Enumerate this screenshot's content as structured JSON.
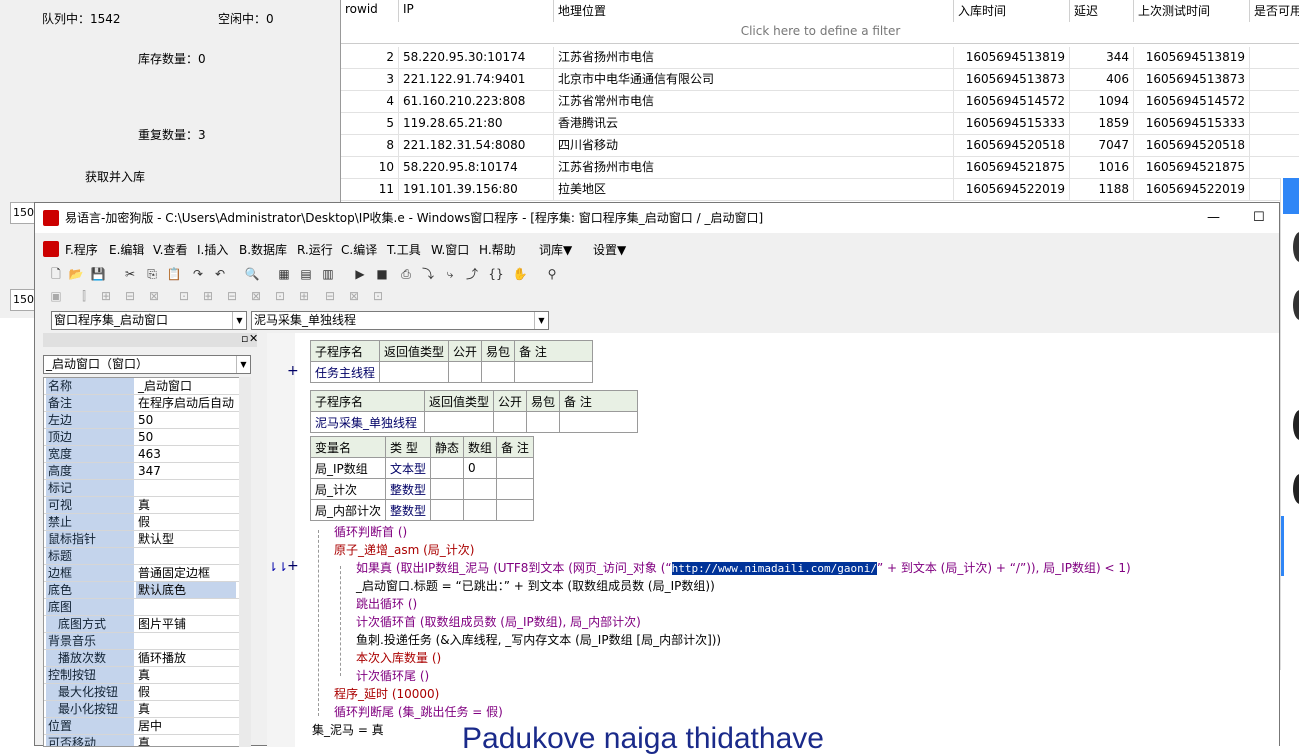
{
  "stats": {
    "queue": "队列中：1542",
    "idle": "空闲中：0",
    "stock": "库存数量：0",
    "dup": "重复数量：3",
    "fetch": "获取并入库",
    "n1": "150",
    "n2": "150"
  },
  "grid": {
    "headers": [
      "rowid",
      "IP",
      "地理位置",
      "入库时间",
      "延迟",
      "上次测试时间",
      "是否可用"
    ],
    "filter": "Click here to define a filter",
    "rows": [
      {
        "id": "2",
        "ip": "58.220.95.30:10174",
        "loc": "江苏省扬州市电信",
        "t": "1605694513819",
        "d": "344",
        "lt": "1605694513819"
      },
      {
        "id": "3",
        "ip": "221.122.91.74:9401",
        "loc": "北京市中电华通通信有限公司",
        "t": "1605694513873",
        "d": "406",
        "lt": "1605694513873"
      },
      {
        "id": "4",
        "ip": "61.160.210.223:808",
        "loc": "江苏省常州市电信",
        "t": "1605694514572",
        "d": "1094",
        "lt": "1605694514572"
      },
      {
        "id": "5",
        "ip": "119.28.65.21:80",
        "loc": "香港腾讯云",
        "t": "1605694515333",
        "d": "1859",
        "lt": "1605694515333"
      },
      {
        "id": "8",
        "ip": "221.182.31.54:8080",
        "loc": "四川省移动",
        "t": "1605694520518",
        "d": "7047",
        "lt": "1605694520518"
      },
      {
        "id": "10",
        "ip": "58.220.95.8:10174",
        "loc": "江苏省扬州市电信",
        "t": "1605694521875",
        "d": "1016",
        "lt": "1605694521875"
      },
      {
        "id": "11",
        "ip": "191.101.39.156:80",
        "loc": "拉美地区",
        "t": "1605694522019",
        "d": "1188",
        "lt": "1605694522019"
      }
    ]
  },
  "window": {
    "title": "易语言-加密狗版 - C:\\Users\\Administrator\\Desktop\\IP收集.e - Windows窗口程序 - [程序集: 窗口程序集_启动窗口 / _启动窗口]",
    "min": "—",
    "max": "☐",
    "menu": [
      "F.程序",
      "E.编辑",
      "V.查看",
      "I.插入",
      "B.数据库",
      "R.运行",
      "C.编译",
      "T.工具",
      "W.窗口",
      "H.帮助",
      "词库▼",
      "设置▼"
    ],
    "combo1": "窗口程序集_启动窗口",
    "combo2": "泥马采集_单独线程"
  },
  "props": {
    "object": "_启动窗口（窗口）",
    "rows": [
      {
        "k": "名称",
        "v": "_启动窗口"
      },
      {
        "k": "备注",
        "v": "在程序启动后自动"
      },
      {
        "k": "左边",
        "v": "50"
      },
      {
        "k": "顶边",
        "v": "50"
      },
      {
        "k": "宽度",
        "v": "463"
      },
      {
        "k": "高度",
        "v": "347"
      },
      {
        "k": "标记",
        "v": ""
      },
      {
        "k": "可视",
        "v": "真"
      },
      {
        "k": "禁止",
        "v": "假"
      },
      {
        "k": "鼠标指针",
        "v": "默认型"
      },
      {
        "k": "标题",
        "v": ""
      },
      {
        "k": "边框",
        "v": "普通固定边框"
      },
      {
        "k": "底色",
        "v": "默认底色"
      },
      {
        "k": "底图",
        "v": ""
      },
      {
        "k": "底图方式",
        "v": "图片平铺"
      },
      {
        "k": "背景音乐",
        "v": ""
      },
      {
        "k": "播放次数",
        "v": "循环播放"
      },
      {
        "k": "控制按钮",
        "v": "真"
      },
      {
        "k": "最大化按钮",
        "v": "假"
      },
      {
        "k": "最小化按钮",
        "v": "真"
      },
      {
        "k": "位置",
        "v": "居中"
      },
      {
        "k": "可否移动",
        "v": "真"
      }
    ]
  },
  "code": {
    "t1": {
      "h": [
        "子程序名",
        "返回值类型",
        "公开",
        "易包",
        "备 注"
      ],
      "r": [
        "任务主线程",
        "",
        "",
        "",
        ""
      ]
    },
    "t2": {
      "h": [
        "子程序名",
        "返回值类型",
        "公开",
        "易包",
        "备 注"
      ],
      "r": [
        "泥马采集_单独线程",
        "",
        "",
        "",
        ""
      ]
    },
    "t3": {
      "h": [
        "变量名",
        "类 型",
        "静态",
        "数组",
        "备 注"
      ],
      "rows": [
        [
          "局_IP数组",
          "文本型",
          "",
          "0",
          ""
        ],
        [
          "局_计次",
          "整数型",
          "",
          "",
          ""
        ],
        [
          "局_内部计次",
          "整数型",
          "",
          "",
          ""
        ]
      ]
    },
    "plus": "+",
    "lines": [
      "循环判断首 ()",
      "原子_递增_asm (局_计次)",
      "如果真 (取出IP数组_泥马 (UTF8到文本 (网页_访问_对象 (“",
      "http://www.nimadaili.com/gaoni/",
      "” + 到文本 (局_计次) + “/”)), 局_IP数组) < 1)",
      "_启动窗口.标题 = “已跳出：” + 到文本 (取数组成员数 (局_IP数组))",
      "跳出循环 ()",
      "计次循环首 (取数组成员数 (局_IP数组), 局_内部计次)",
      "鱼刺.投递任务 (&入库线程, _写内存文本 (局_IP数组 [局_内部计次]))",
      "本次入库数量 ()",
      "计次循环尾 ()",
      "程序_延时 (10000)",
      "循环判断尾 (集_跳出任务 = 假)",
      "集_泥马 = 真"
    ]
  },
  "subtitle": "Padukove naiga thidathave"
}
